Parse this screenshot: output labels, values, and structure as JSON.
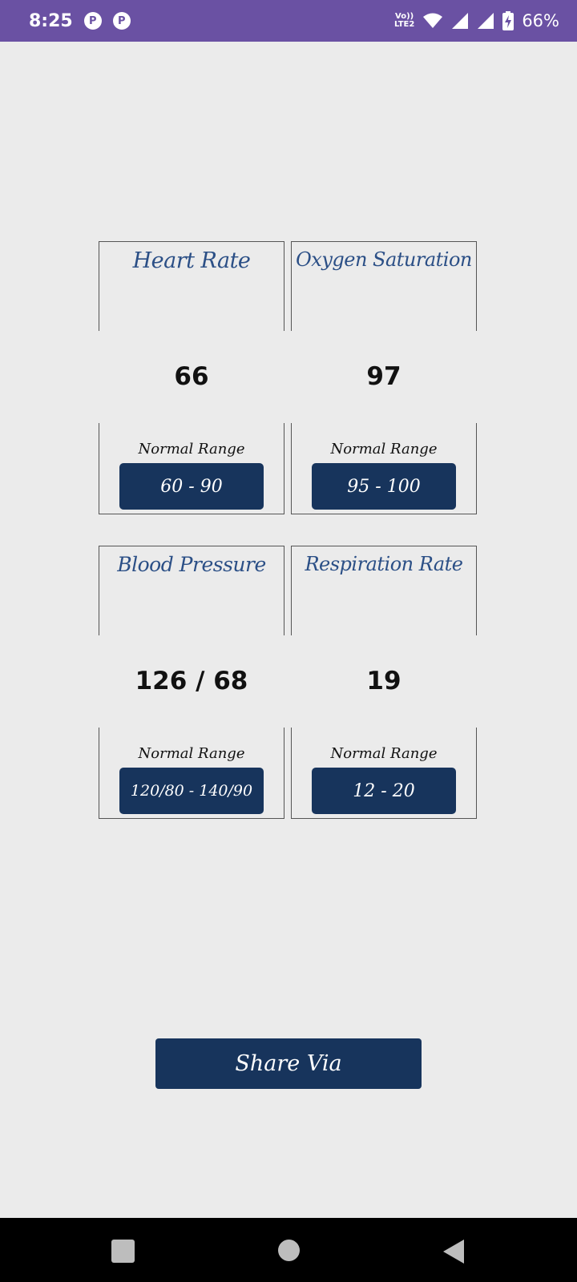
{
  "status_bar": {
    "time": "8:25",
    "app_icon_1": "P",
    "app_icon_2": "P",
    "volte_line1": "Vo))",
    "volte_line2": "LTE2",
    "battery_percent": "66%"
  },
  "vitals": [
    {
      "title": "Heart Rate",
      "value": "66",
      "range_label": "Normal Range",
      "range": "60 - 90"
    },
    {
      "title": "Oxygen Saturation",
      "value": "97",
      "range_label": "Normal Range",
      "range": "95 - 100"
    },
    {
      "title": "Blood Pressure",
      "value": "126 / 68",
      "range_label": "Normal Range",
      "range": "120/80 - 140/90"
    },
    {
      "title": "Respiration Rate",
      "value": "19",
      "range_label": "Normal Range",
      "range": "12 - 20"
    }
  ],
  "share_button_label": "Share Via",
  "colors": {
    "status_bar": "#6a51a3",
    "background": "#ebebeb",
    "title_text": "#2b4f86",
    "button": "#17345c"
  }
}
